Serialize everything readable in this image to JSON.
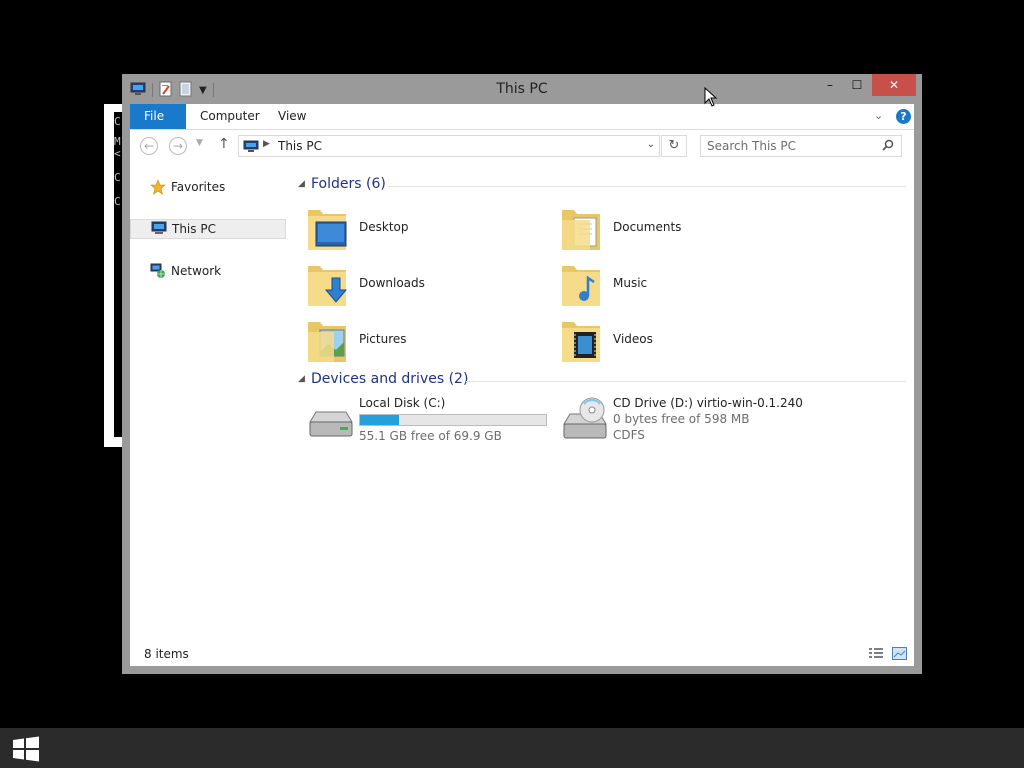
{
  "background": {
    "console_lines": [
      "C",
      "M",
      "<",
      "C",
      "C"
    ]
  },
  "window": {
    "title": "This PC",
    "controls": {
      "minimize": "–",
      "maximize": "☐",
      "close": "✕"
    }
  },
  "ribbon": {
    "tabs": [
      "File",
      "Computer",
      "View"
    ],
    "help": "?"
  },
  "navigation": {
    "address": "This PC",
    "search_placeholder": "Search This PC"
  },
  "nav_pane": {
    "items": [
      {
        "label": "Favorites",
        "icon": "star-icon"
      },
      {
        "label": "This PC",
        "icon": "computer-icon",
        "selected": true
      },
      {
        "label": "Network",
        "icon": "network-icon"
      }
    ]
  },
  "content": {
    "folders_header": "Folders (6)",
    "folders": [
      {
        "name": "Desktop",
        "icon": "desktop-folder-icon"
      },
      {
        "name": "Documents",
        "icon": "documents-folder-icon"
      },
      {
        "name": "Downloads",
        "icon": "downloads-folder-icon"
      },
      {
        "name": "Music",
        "icon": "music-folder-icon"
      },
      {
        "name": "Pictures",
        "icon": "pictures-folder-icon"
      },
      {
        "name": "Videos",
        "icon": "videos-folder-icon"
      }
    ],
    "devices_header": "Devices and drives (2)",
    "drives": [
      {
        "name": "Local Disk (C:)",
        "detail": "55.1 GB free of 69.9 GB",
        "used_fraction": 0.21,
        "icon": "hard-disk-icon"
      },
      {
        "name": "CD Drive (D:) virtio-win-0.1.240",
        "detail": "0 bytes free of 598 MB",
        "filesystem": "CDFS",
        "icon": "cd-drive-icon"
      }
    ]
  },
  "status": {
    "items": "8 items"
  },
  "colors": {
    "accent": "#1979ca",
    "group_title": "#1e3287",
    "progress": "#26a0da",
    "close": "#c7514a"
  }
}
